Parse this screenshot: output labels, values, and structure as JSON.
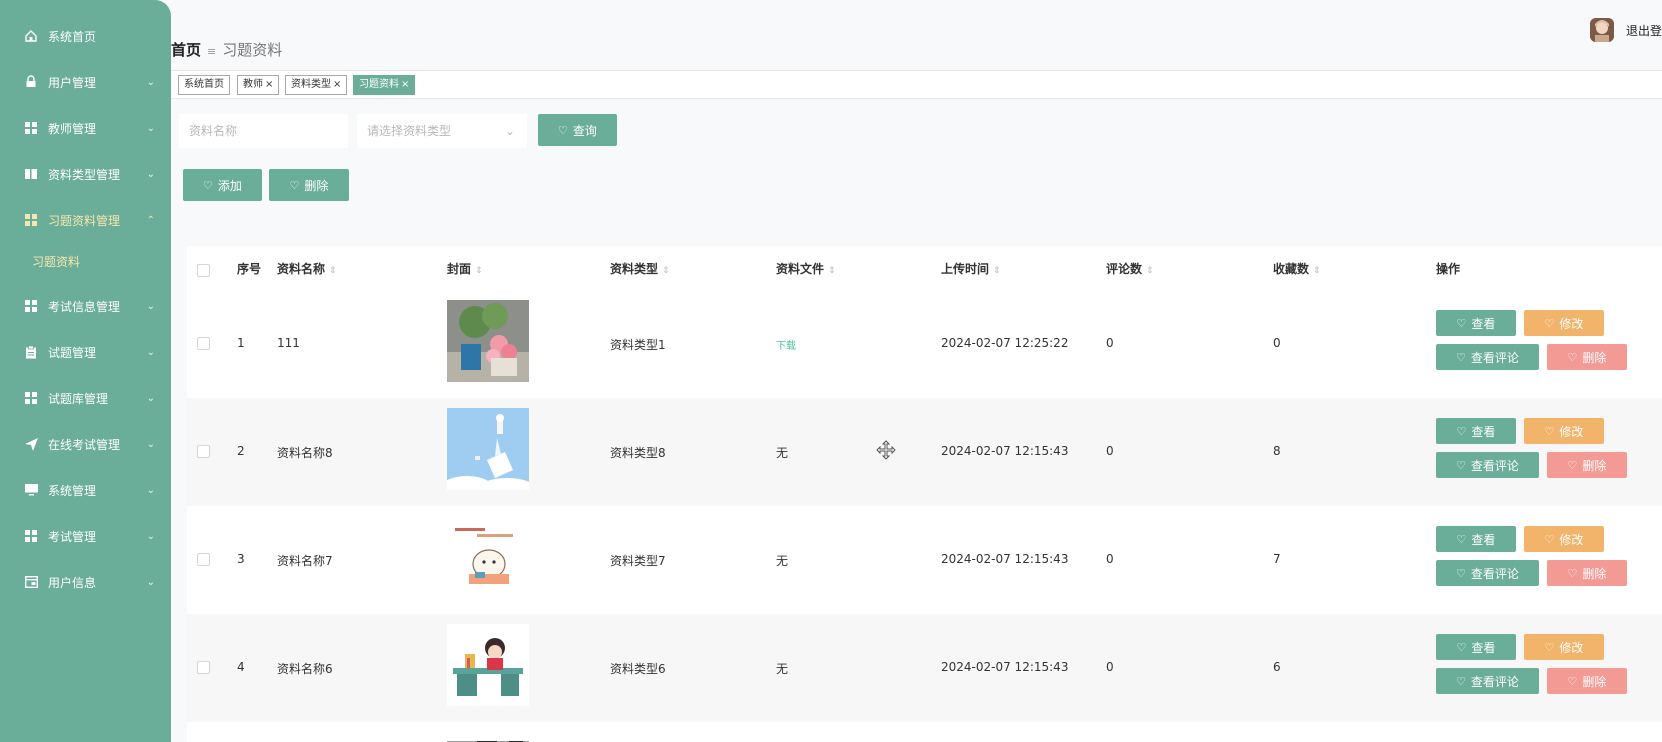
{
  "sidebar": {
    "items": [
      {
        "label": "系统首页",
        "icon": "home-icon",
        "has_arrow": false
      },
      {
        "label": "用户管理",
        "icon": "lock-icon",
        "has_arrow": true
      },
      {
        "label": "教师管理",
        "icon": "grid-icon",
        "has_arrow": true
      },
      {
        "label": "资料类型管理",
        "icon": "book-icon",
        "has_arrow": true
      },
      {
        "label": "习题资料管理",
        "icon": "grid-icon",
        "has_arrow": true,
        "expanded": true
      },
      {
        "label": "考试信息管理",
        "icon": "grid-icon",
        "has_arrow": true
      },
      {
        "label": "试题管理",
        "icon": "clipboard-icon",
        "has_arrow": true
      },
      {
        "label": "试题库管理",
        "icon": "grid-icon",
        "has_arrow": true
      },
      {
        "label": "在线考试管理",
        "icon": "send-icon",
        "has_arrow": true
      },
      {
        "label": "系统管理",
        "icon": "monitor-icon",
        "has_arrow": true
      },
      {
        "label": "考试管理",
        "icon": "grid-icon",
        "has_arrow": true
      },
      {
        "label": "用户信息",
        "icon": "card-icon",
        "has_arrow": true
      }
    ],
    "submenu": {
      "label": "习题资料"
    }
  },
  "header": {
    "breadcrumb_home": "首页",
    "breadcrumb_separator": "≡",
    "breadcrumb_current": "习题资料",
    "logout": "退出登录"
  },
  "tags": [
    {
      "label": "系统首页",
      "closable": false,
      "active": false
    },
    {
      "label": "教师",
      "closable": true,
      "active": false
    },
    {
      "label": "资料类型",
      "closable": true,
      "active": false
    },
    {
      "label": "习题资料",
      "closable": true,
      "active": true
    }
  ],
  "tag_close_glyph": "×",
  "search": {
    "name_placeholder": "资料名称",
    "type_placeholder": "请选择资料类型",
    "query_label": "查询"
  },
  "toolbar": {
    "add_label": "添加",
    "delete_label": "删除"
  },
  "table": {
    "columns": [
      "序号",
      "资料名称",
      "封面",
      "资料类型",
      "资料文件",
      "上传时间",
      "评论数",
      "收藏数",
      "操作"
    ],
    "sort_glyph": "⇕",
    "rows": [
      {
        "index": "1",
        "name": "111",
        "type": "资料类型1",
        "file": "下载",
        "file_is_link": true,
        "time": "2024-02-07 12:25:22",
        "comments": "0",
        "favorites": "0"
      },
      {
        "index": "2",
        "name": "资料名称8",
        "type": "资料类型8",
        "file": "无",
        "file_is_link": false,
        "time": "2024-02-07 12:15:43",
        "comments": "0",
        "favorites": "8"
      },
      {
        "index": "3",
        "name": "资料名称7",
        "type": "资料类型7",
        "file": "无",
        "file_is_link": false,
        "time": "2024-02-07 12:15:43",
        "comments": "0",
        "favorites": "7"
      },
      {
        "index": "4",
        "name": "资料名称6",
        "type": "资料类型6",
        "file": "无",
        "file_is_link": false,
        "time": "2024-02-07 12:15:43",
        "comments": "0",
        "favorites": "6"
      }
    ],
    "actions": {
      "view": "查看",
      "edit": "修改",
      "view_comments": "查看评论",
      "delete": "删除"
    }
  },
  "colors": {
    "accent": "#6aad98",
    "edit": "#f1b46a",
    "delete": "#f39a95",
    "link": "#47c3a0",
    "active_menu_text": "#f6e6b0"
  }
}
